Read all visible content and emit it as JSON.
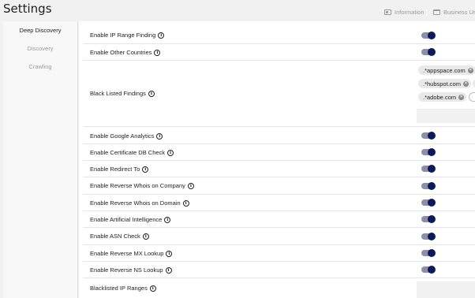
{
  "header": {
    "title": "Settings",
    "links": [
      {
        "label": "Information",
        "icon": "id-card-icon"
      },
      {
        "label": "Business Uni",
        "icon": "folder-icon"
      }
    ]
  },
  "sidebar": {
    "items": [
      {
        "label": "Deep Discovery",
        "active": true
      },
      {
        "label": "Discovery",
        "active": false
      },
      {
        "label": "Crawling",
        "active": false
      }
    ]
  },
  "settings": {
    "ip_range_finding": {
      "label": "Enable IP Range Finding",
      "enabled": true
    },
    "other_countries": {
      "label": "Enable Other Countries",
      "enabled": true
    },
    "black_listed_findings": {
      "label": "Black Listed Findings",
      "chips": [
        ".*appspace.com",
        ".*hubspot.com",
        ".*adobe.com"
      ]
    },
    "google_analytics": {
      "label": "Enable Google Analytics",
      "enabled": true
    },
    "certificate_db": {
      "label": "Enable Certificate DB Check",
      "enabled": true
    },
    "redirect_to": {
      "label": "Enable Redirect To",
      "enabled": true
    },
    "reverse_whois_company": {
      "label": "Enable Reverse Whois on Company",
      "enabled": true
    },
    "reverse_whois_domain": {
      "label": "Enable Reverse Whois on Domain",
      "enabled": true
    },
    "artificial_intelligence": {
      "label": "Enable Artificial Intelligence",
      "enabled": true
    },
    "asn_check": {
      "label": "Enable ASN Check",
      "enabled": true
    },
    "reverse_mx": {
      "label": "Enable Reverse MX Lookup",
      "enabled": true
    },
    "reverse_ns": {
      "label": "Enable Reverse NS Lookup",
      "enabled": true
    },
    "blacklisted_ip_ranges": {
      "label": "Blacklisted IP Ranges"
    }
  },
  "colors": {
    "toggle_track": "#8c8fa6",
    "toggle_knob": "#0b1a5c",
    "active_bar": "#2a2a2a"
  }
}
